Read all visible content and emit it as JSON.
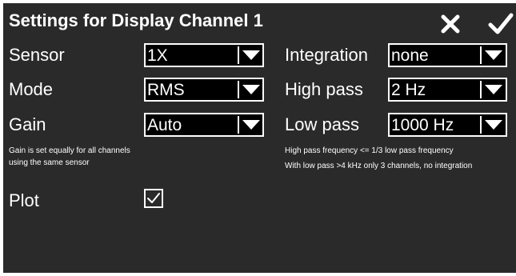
{
  "header": {
    "title": "Settings for Display Channel 1",
    "close_icon": "close-x-icon",
    "confirm_icon": "checkmark-icon"
  },
  "left": {
    "sensor": {
      "label": "Sensor",
      "value": "1X"
    },
    "mode": {
      "label": "Mode",
      "value": "RMS"
    },
    "gain": {
      "label": "Gain",
      "value": "Auto"
    },
    "note_line1": "Gain is set equally for all channels",
    "note_line2": "using the same sensor",
    "plot": {
      "label": "Plot",
      "checked": true
    }
  },
  "right": {
    "integration": {
      "label": "Integration",
      "value": "none"
    },
    "high_pass": {
      "label": "High pass",
      "value": "2 Hz"
    },
    "low_pass": {
      "label": "Low pass",
      "value": "1000 Hz"
    },
    "note_line1": "High pass frequency <= 1/3 low pass frequency",
    "note_line2": "With low pass >4 kHz only 3 channels, no integration"
  },
  "colors": {
    "panel_background": "#2a2a2a",
    "control_background": "#000000",
    "foreground": "#ffffff"
  }
}
